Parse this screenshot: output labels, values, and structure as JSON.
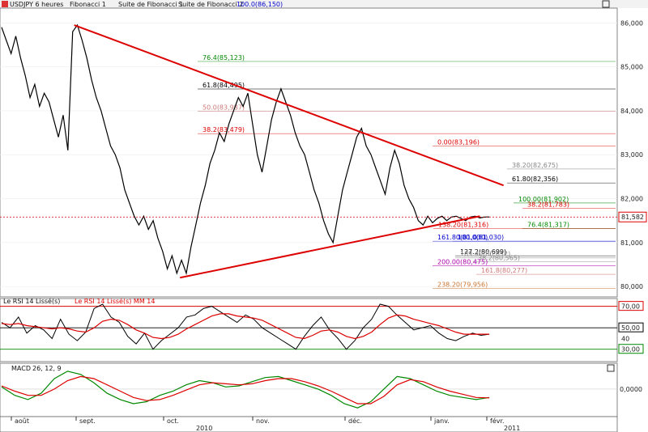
{
  "toolbar": {
    "symbol": "USDJPY 6 heures",
    "studies": [
      "Fibonacci 1",
      "Suite de Fibonacci 1",
      "Suite de Fibonacci 2"
    ],
    "top_label": "100.0(86,150)"
  },
  "colors": {
    "price_line": "#000000",
    "trendline": "#dd0000",
    "rsi": "#000000",
    "rsi_ma": "#dd0000",
    "macd": "#008800",
    "macd_signal": "#dd0000",
    "last_price_badge": "#dd0000"
  },
  "chart_data": [
    {
      "type": "line",
      "panel": "price",
      "ylim": [
        79.8,
        86.3
      ],
      "ticks": [
        "86,000",
        "85,000",
        "84,000",
        "83,000",
        "82,000",
        "81,000",
        "80,000"
      ],
      "last_price": "81,582",
      "x_months": [
        "août",
        "sept.",
        "oct.",
        "nov.",
        "déc.",
        "janv.",
        "févr."
      ],
      "x_years": [
        "2010",
        "2011"
      ],
      "series": [
        {
          "x": [
            0,
            3,
            6,
            9,
            12,
            15,
            18,
            21,
            24,
            27,
            30,
            33,
            36,
            39,
            42,
            45,
            48,
            51,
            54,
            57,
            60,
            63,
            66,
            69,
            72,
            75,
            78,
            81,
            84,
            87,
            90,
            93,
            96,
            99,
            102,
            105,
            108,
            111,
            114,
            117,
            120,
            123,
            126,
            129,
            132,
            135,
            138,
            141,
            144,
            147,
            150,
            153,
            156,
            159,
            162,
            165,
            168,
            171,
            174,
            177,
            180,
            183,
            186,
            189,
            192,
            195,
            198,
            201,
            204,
            207,
            210,
            213,
            216,
            219,
            222,
            225,
            228,
            231,
            234,
            237,
            240,
            243,
            246,
            249,
            252,
            255,
            258,
            261,
            264,
            267,
            270,
            273,
            276,
            279,
            282,
            285,
            288,
            291,
            294,
            297,
            300,
            303,
            306,
            309
          ],
          "y": [
            85.9,
            85.6,
            85.3,
            85.7,
            85.2,
            84.8,
            84.3,
            84.6,
            84.1,
            84.4,
            84.2,
            83.8,
            83.4,
            83.9,
            83.1,
            85.8,
            85.95,
            85.6,
            85.2,
            84.7,
            84.3,
            84.0,
            83.6,
            83.2,
            83.0,
            82.7,
            82.2,
            81.9,
            81.6,
            81.4,
            81.6,
            81.3,
            81.5,
            81.1,
            80.8,
            80.4,
            80.7,
            80.3,
            80.6,
            80.3,
            80.9,
            81.4,
            81.9,
            82.3,
            82.8,
            83.1,
            83.5,
            83.3,
            83.7,
            84.0,
            84.3,
            84.1,
            84.4,
            83.7,
            83.0,
            82.6,
            83.2,
            83.8,
            84.2,
            84.5,
            84.2,
            83.9,
            83.5,
            83.2,
            83.0,
            82.6,
            82.2,
            81.9,
            81.5,
            81.2,
            81.0,
            81.6,
            82.2,
            82.6,
            83.0,
            83.4,
            83.6,
            83.2,
            83.0,
            82.7,
            82.4,
            82.1,
            82.7,
            83.1,
            82.8,
            82.3,
            82.0,
            81.8,
            81.5,
            81.4,
            81.6,
            81.45,
            81.55,
            81.6,
            81.5,
            81.58,
            81.6,
            81.55,
            81.5,
            81.58,
            81.6,
            81.56,
            81.58,
            81.582
          ]
        }
      ],
      "trendlines": [
        {
          "name": "resistance",
          "x": [
            46,
            318
          ],
          "y": [
            85.95,
            82.3
          ]
        },
        {
          "name": "support",
          "x": [
            113,
            303
          ],
          "y": [
            80.2,
            81.6
          ]
        }
      ],
      "fib_levels": [
        {
          "label": "76.4(85,123)",
          "value": 85.123,
          "color": "#008800"
        },
        {
          "label": "61.8(84,495)",
          "value": 84.495,
          "color": "#000000"
        },
        {
          "label": "50.0(83,987)",
          "value": 83.987,
          "color": "#cc7777"
        },
        {
          "label": "38.2(83,479)",
          "value": 83.479,
          "color": "#dd0000"
        },
        {
          "label": "0.00(83,196)",
          "value": 83.196,
          "color": "#dd0000"
        },
        {
          "label": "38.20(82,675)",
          "value": 82.675,
          "color": "#888888"
        },
        {
          "label": "61.80(82,356)",
          "value": 82.356,
          "color": "#000000"
        },
        {
          "label": "100.00(81,902)",
          "value": 81.902,
          "color": "#008800"
        },
        {
          "label": "38.2(81,783)",
          "value": 81.783,
          "color": "#dd0000"
        },
        {
          "label": "76.4(81,317)",
          "value": 81.317,
          "color": "#008800"
        },
        {
          "label": "138.20(81,316)",
          "value": 81.316,
          "color": "#dd0000"
        },
        {
          "label": "100.0(81,030)",
          "value": 81.03,
          "color": "#0000cc"
        },
        {
          "label": "161.80(81,030)",
          "value": 81.03,
          "color": "#0000cc"
        },
        {
          "label": "127.2(80,699)",
          "value": 80.699,
          "color": "#000000"
        },
        {
          "label": "189.40(80,652)",
          "value": 80.652,
          "color": "#888888"
        },
        {
          "label": "38.2(80,565)",
          "value": 80.565,
          "color": "#888888"
        },
        {
          "label": "200.00(80,475)",
          "value": 80.475,
          "color": "#aa00aa"
        },
        {
          "label": "161.8(80,277)",
          "value": 80.277,
          "color": "#cc7777"
        },
        {
          "label": "238.20(79,956)",
          "value": 79.956,
          "color": "#cc7733"
        }
      ]
    },
    {
      "type": "line",
      "panel": "rsi",
      "title": "Le RSI 14 Lissé(s)",
      "title2": "Le RSI 14 Lissé(s) MM 14",
      "ylim": [
        20,
        75
      ],
      "ticks": [
        "70,00",
        "50,00",
        "40",
        "30,00"
      ],
      "levels": [
        70,
        50,
        30
      ],
      "series": [
        {
          "name": "RSI",
          "values": [
            55,
            50,
            60,
            45,
            52,
            48,
            40,
            58,
            44,
            38,
            46,
            68,
            72,
            60,
            55,
            42,
            35,
            45,
            30,
            38,
            44,
            50,
            60,
            62,
            68,
            70,
            65,
            60,
            55,
            62,
            58,
            50,
            45,
            40,
            35,
            30,
            42,
            52,
            60,
            48,
            40,
            30,
            38,
            50,
            58,
            72,
            70,
            62,
            55,
            48,
            50,
            52,
            45,
            40,
            38,
            42,
            45,
            43,
            44
          ]
        },
        {
          "name": "MM 14",
          "values": [
            54,
            53,
            54,
            52,
            51,
            50,
            49,
            50,
            49,
            47,
            46,
            50,
            56,
            58,
            57,
            53,
            48,
            45,
            41,
            40,
            41,
            44,
            49,
            53,
            57,
            61,
            63,
            63,
            61,
            60,
            59,
            57,
            53,
            49,
            45,
            41,
            40,
            43,
            47,
            48,
            46,
            42,
            40,
            42,
            46,
            53,
            59,
            62,
            61,
            58,
            56,
            54,
            52,
            49,
            46,
            44,
            44,
            44,
            44
          ]
        }
      ]
    },
    {
      "type": "line",
      "panel": "macd",
      "title": "MACD",
      "params": "26, 12, 9",
      "ylim": [
        -1.2,
        1.0
      ],
      "ticks": [
        "0,0000"
      ],
      "series": [
        {
          "name": "MACD",
          "values": [
            0.1,
            -0.3,
            -0.5,
            -0.2,
            0.5,
            0.85,
            0.7,
            0.3,
            -0.2,
            -0.5,
            -0.7,
            -0.6,
            -0.3,
            -0.1,
            0.2,
            0.4,
            0.3,
            0.1,
            0.15,
            0.35,
            0.55,
            0.6,
            0.4,
            0.2,
            0.0,
            -0.3,
            -0.7,
            -0.9,
            -0.6,
            0.0,
            0.6,
            0.5,
            0.2,
            -0.1,
            -0.3,
            -0.4,
            -0.5,
            -0.4
          ]
        },
        {
          "name": "Signal",
          "values": [
            0.15,
            -0.1,
            -0.3,
            -0.3,
            0.0,
            0.4,
            0.6,
            0.5,
            0.2,
            -0.1,
            -0.4,
            -0.55,
            -0.5,
            -0.3,
            -0.05,
            0.2,
            0.3,
            0.25,
            0.2,
            0.25,
            0.4,
            0.5,
            0.5,
            0.35,
            0.15,
            -0.1,
            -0.4,
            -0.7,
            -0.7,
            -0.35,
            0.2,
            0.45,
            0.35,
            0.1,
            -0.1,
            -0.25,
            -0.4,
            -0.42
          ]
        }
      ]
    }
  ]
}
